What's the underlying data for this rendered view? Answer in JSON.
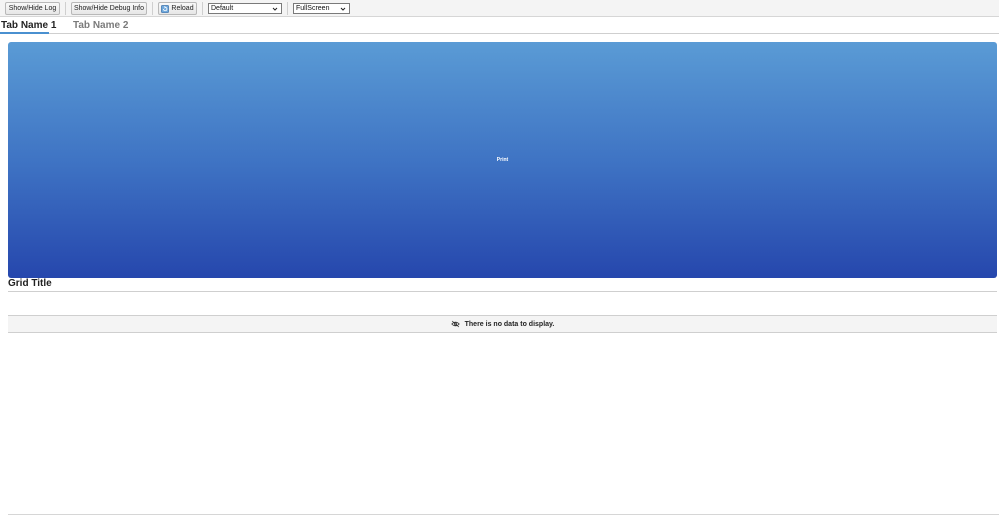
{
  "toolbar": {
    "show_hide_log": "Show/Hide Log",
    "show_hide_debug": "Show/Hide Debug Info",
    "reload": "Reload",
    "theme_select": "Default",
    "mode_select": "FullScreen"
  },
  "tabs": [
    {
      "label": "Tab Name 1",
      "active": true
    },
    {
      "label": "Tab Name 2",
      "active": false
    }
  ],
  "print_panel": {
    "label": "Print",
    "gradient_top": "#5a9bd5",
    "gradient_bottom": "#2647ad"
  },
  "grid": {
    "title": "Grid Title",
    "empty_message": "There is no data to display."
  },
  "icons": {
    "reload": "reload-icon",
    "no_data": "eye-slash-icon"
  }
}
